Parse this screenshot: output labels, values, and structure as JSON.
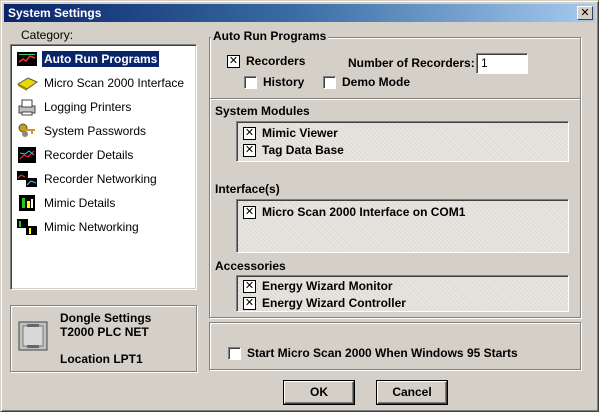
{
  "window": {
    "title": "System Settings",
    "close_glyph": "✕"
  },
  "category": {
    "label": "Category:",
    "items": [
      {
        "label": "Auto Run Programs",
        "icon": "monitor-chart-icon",
        "selected": true
      },
      {
        "label": "Micro Scan 2000 Interface",
        "icon": "interface-card-icon"
      },
      {
        "label": "Logging Printers",
        "icon": "printer-icon"
      },
      {
        "label": "System Passwords",
        "icon": "keys-icon"
      },
      {
        "label": "Recorder Details",
        "icon": "recorder-icon"
      },
      {
        "label": "Recorder Networking",
        "icon": "recorder-network-icon"
      },
      {
        "label": "Mimic Details",
        "icon": "mimic-icon"
      },
      {
        "label": "Mimic Networking",
        "icon": "mimic-network-icon"
      }
    ]
  },
  "dongle": {
    "title": "Dongle Settings",
    "model": "T2000 PLC NET",
    "location": "Location LPT1"
  },
  "auto_run": {
    "group_label": "Auto Run Programs",
    "recorders": {
      "label": "Recorders",
      "checked": "✕"
    },
    "num_recorders_label": "Number of Recorders:",
    "num_recorders_value": "1",
    "history": {
      "label": "History",
      "checked": ""
    },
    "demo_mode": {
      "label": "Demo Mode",
      "checked": ""
    }
  },
  "system_modules": {
    "label": "System Modules",
    "items": [
      {
        "label": "Mimic Viewer",
        "checked": "✕"
      },
      {
        "label": "Tag Data Base",
        "checked": "✕"
      }
    ]
  },
  "interfaces": {
    "label": "Interface(s)",
    "items": [
      {
        "label": "Micro Scan 2000 Interface on COM1",
        "checked": "✕"
      }
    ]
  },
  "accessories": {
    "label": "Accessories",
    "items": [
      {
        "label": "Energy Wizard Monitor",
        "checked": "✕"
      },
      {
        "label": "Energy Wizard Controller",
        "checked": "✕"
      }
    ]
  },
  "startup": {
    "label": "Start Micro Scan 2000 When Windows 95 Starts",
    "checked": ""
  },
  "buttons": {
    "ok": "OK",
    "cancel": "Cancel"
  }
}
